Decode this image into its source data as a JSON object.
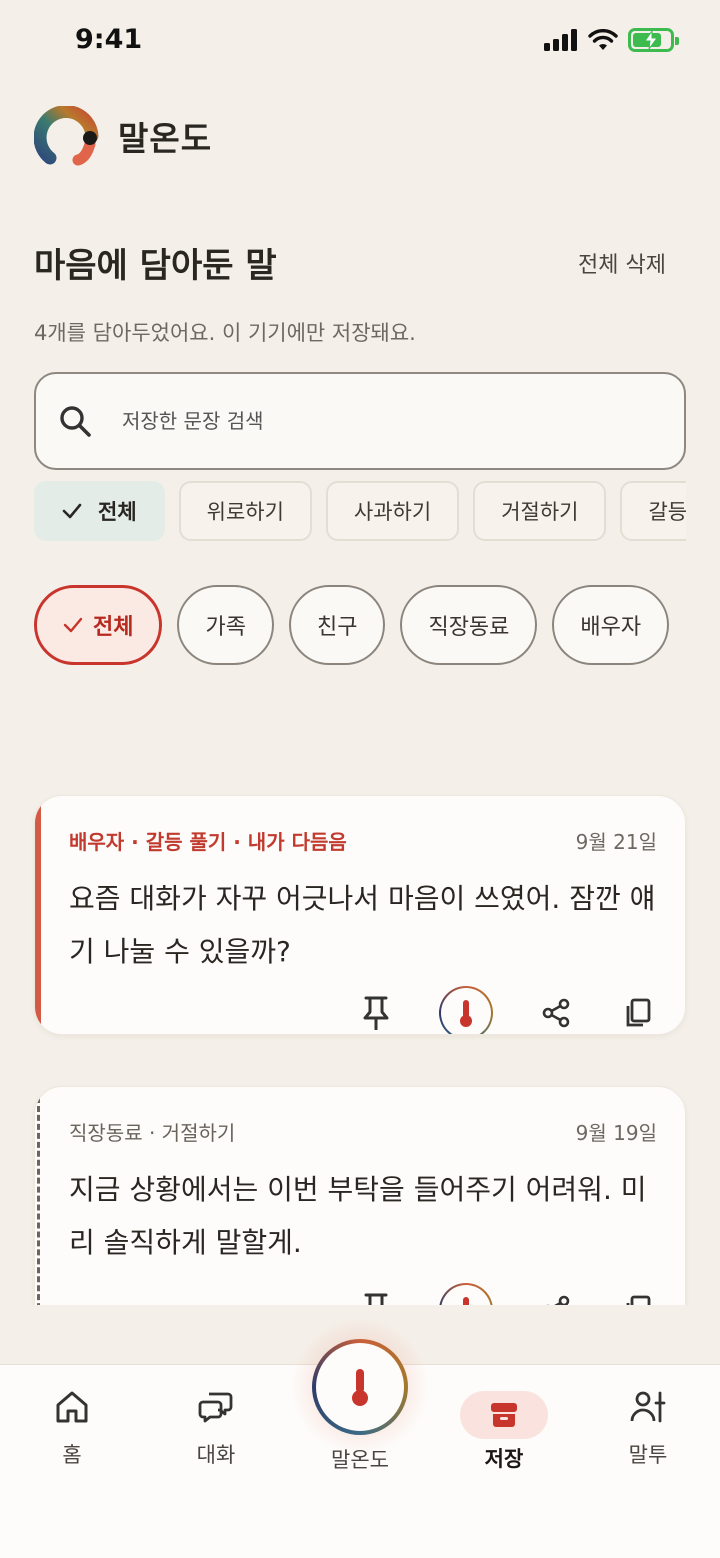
{
  "status_bar": {
    "time": "9:41"
  },
  "app": {
    "name": "말온도"
  },
  "header": {
    "title": "마음에 담아둔 말",
    "delete_all": "전체 삭제",
    "subtitle": "4개를 담아두었어요. 이 기기에만 저장돼요."
  },
  "search": {
    "placeholder": "저장한 문장 검색"
  },
  "situation_filters": [
    {
      "label": "전체",
      "selected": true
    },
    {
      "label": "위로하기",
      "selected": false
    },
    {
      "label": "사과하기",
      "selected": false
    },
    {
      "label": "거절하기",
      "selected": false
    },
    {
      "label": "갈등 풀기",
      "selected": false
    }
  ],
  "relation_filters": [
    {
      "label": "전체",
      "selected": true
    },
    {
      "label": "가족",
      "selected": false
    },
    {
      "label": "친구",
      "selected": false
    },
    {
      "label": "직장동료",
      "selected": false
    },
    {
      "label": "배우자",
      "selected": false
    }
  ],
  "cards": [
    {
      "meta": "배우자 · 갈등 풀기 · 내가 다듬음",
      "date": "9월 21일",
      "text": "요즘 대화가 자꾸 어긋나서 마음이 쓰였어. 잠깐 얘기 나눌 수 있을까?",
      "edited_by_me": true,
      "accent_color": "#d35a44"
    },
    {
      "meta": "직장동료 · 거절하기",
      "date": "9월 19일",
      "text": "지금 상황에서는 이번 부탁을 들어주기 어려워. 미리 솔직하게 말할게.",
      "edited_by_me": false
    }
  ],
  "card_actions": [
    "pin-icon",
    "thermometer-icon",
    "share-icon",
    "copy-icon"
  ],
  "bottom_nav": {
    "home": "홈",
    "chat": "대화",
    "center": "말온도",
    "saved": "저장",
    "tone": "말투",
    "active": "saved"
  },
  "colors": {
    "background": "#f4f0e9",
    "accent_red": "#c8352c",
    "selected_chip_bg": "#e3ece7",
    "nav_active_pill": "#fae3de"
  }
}
